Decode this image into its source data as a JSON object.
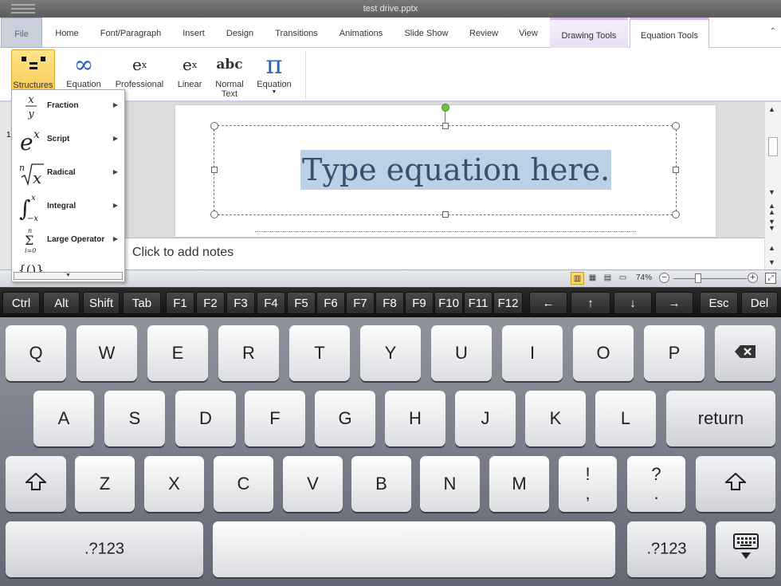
{
  "window": {
    "title": "test drive.pptx"
  },
  "tabs": [
    "File",
    "Home",
    "Font/Paragraph",
    "Insert",
    "Design",
    "Transitions",
    "Animations",
    "Slide Show",
    "Review",
    "View",
    "Drawing Tools",
    "Equation Tools"
  ],
  "ribbon": {
    "buttons": [
      {
        "label": "Structures",
        "icon": "structures-icon"
      },
      {
        "label": "Equation",
        "icon": "infinity-icon"
      },
      {
        "label": "Professional",
        "icon": "professional-icon"
      },
      {
        "label": "Linear",
        "icon": "linear-icon"
      },
      {
        "label": "Normal\nText",
        "icon": "abc-icon"
      },
      {
        "label": "Equation",
        "icon": "pi-icon"
      }
    ]
  },
  "structures_menu": [
    {
      "label": "Fraction",
      "icon": "fraction-icon"
    },
    {
      "label": "Script",
      "icon": "script-icon"
    },
    {
      "label": "Radical",
      "icon": "radical-icon"
    },
    {
      "label": "Integral",
      "icon": "integral-icon"
    },
    {
      "label": "Large Operator",
      "icon": "large-operator-icon"
    }
  ],
  "slide": {
    "equation_text": "Type equation here.",
    "slide_number": "1"
  },
  "notes": {
    "placeholder": "Click to add notes"
  },
  "status": {
    "zoom": "74%"
  },
  "function_keys": [
    "Ctrl",
    "Alt",
    "Shift",
    "Tab",
    "F1",
    "F2",
    "F3",
    "F4",
    "F5",
    "F6",
    "F7",
    "F8",
    "F9",
    "F10",
    "F11",
    "F12",
    "←",
    "↑",
    "↓",
    "→",
    "Esc",
    "Del"
  ],
  "keyboard": {
    "row1": [
      "Q",
      "W",
      "E",
      "R",
      "T",
      "Y",
      "U",
      "I",
      "O",
      "P"
    ],
    "row2": [
      "A",
      "S",
      "D",
      "F",
      "G",
      "H",
      "J",
      "K",
      "L"
    ],
    "row3": [
      "Z",
      "X",
      "C",
      "V",
      "B",
      "N",
      "M",
      "!\n,",
      "?\n."
    ],
    "return_label": "return",
    "numbers_label": ".?123",
    "backspace_icon": "backspace-icon",
    "shift_icon": "shift-icon",
    "hide_keyboard_icon": "hide-keyboard-icon"
  }
}
